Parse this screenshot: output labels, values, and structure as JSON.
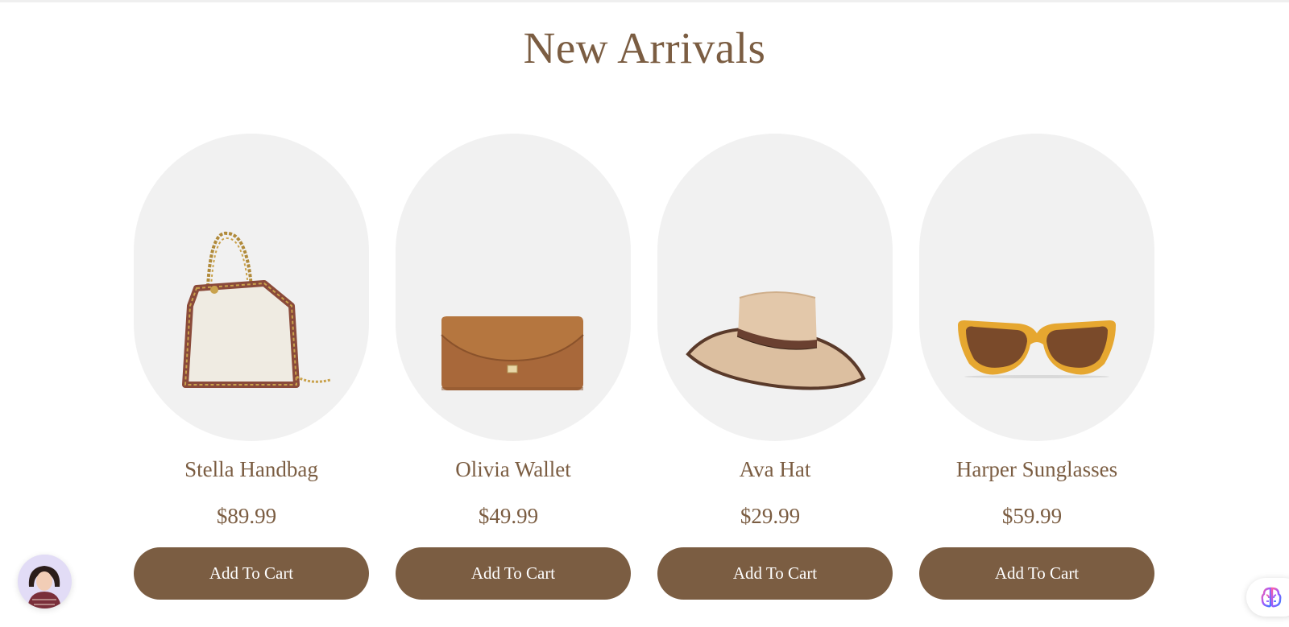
{
  "section": {
    "title": "New Arrivals"
  },
  "products": [
    {
      "name": "Stella Handbag",
      "price": "$89.99",
      "button_label": "Add To Cart",
      "icon": "handbag-image"
    },
    {
      "name": "Olivia Wallet",
      "price": "$49.99",
      "button_label": "Add To Cart",
      "icon": "wallet-image"
    },
    {
      "name": "Ava Hat",
      "price": "$29.99",
      "button_label": "Add To Cart",
      "icon": "hat-image"
    },
    {
      "name": "Harper Sunglasses",
      "price": "$59.99",
      "button_label": "Add To Cart",
      "icon": "sunglasses-image"
    }
  ],
  "widgets": {
    "left": "assistant-avatar",
    "right": "brain-icon"
  },
  "colors": {
    "brand": "#7b5d42",
    "card_bg": "#f1f1f1",
    "page_bg": "#ffffff"
  }
}
